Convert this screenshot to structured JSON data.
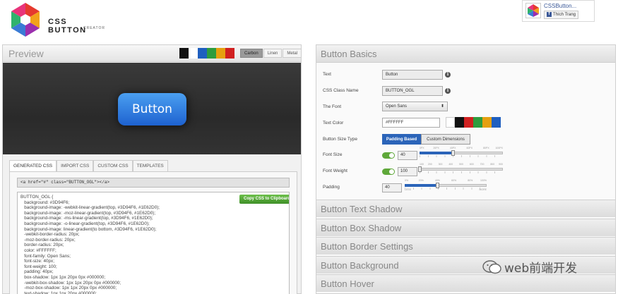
{
  "header": {
    "logo_title": "CSS BUTTON",
    "logo_subtitle": "CREATOR",
    "facebook": {
      "name": "CSSButton...",
      "like_label": "Thích Trang"
    }
  },
  "preview": {
    "title": "Preview",
    "swatch_colors": [
      "#111111",
      "#ffffff",
      "#1f5fbf",
      "#2e9c3e",
      "#e5a010",
      "#d02020"
    ],
    "themes": [
      {
        "label": "Carbon",
        "active": true
      },
      {
        "label": "Linen",
        "active": false
      },
      {
        "label": "Metal",
        "active": false
      }
    ],
    "button_label": "Button",
    "tabs": [
      {
        "label": "GENERATED CSS",
        "active": true
      },
      {
        "label": "IMPORT CSS",
        "active": false
      },
      {
        "label": "CUSTOM CSS",
        "active": false
      },
      {
        "label": "TEMPLATES",
        "active": false
      }
    ],
    "html_snippet": "<a href=\"#\" class=\"BUTTON_OGL\"></a>",
    "copy_label": "Copy CSS to Clipboard",
    "css_lines": [
      "BUTTON_OGL {",
      "   background: #3D94F6;",
      "   background-image: -webkit-linear-gradient(top, #3D94F6, #1E62D0);",
      "   background-image: -moz-linear-gradient(top, #3D94F6, #1E62D0);",
      "   background-image: -ms-linear-gradient(top, #3D94F6, #1E62D0);",
      "   background-image: -o-linear-gradient(top, #3D94F6, #1E62D0);",
      "   background-image: linear-gradient(to bottom, #3D94F6, #1E62D0);",
      "   -webkit-border-radius: 20px;",
      "   -moz-border-radius: 20px;",
      "   border-radius: 20px;",
      "   color: #FFFFFF;",
      "   font-family: Open Sans;",
      "   font-size: 40px;",
      "   font-weight: 100;",
      "   padding: 40px;",
      "   box-shadow: 1px 1px 20px 0px #000000;",
      "   -webkit-box-shadow: 1px 1px 20px 0px #000000;",
      "   -moz-box-shadow: 1px 1px 20px 0px #000000;",
      "   text-shadow: 1px 1px 20px #000000;"
    ]
  },
  "basics": {
    "title": "Button Basics",
    "text_label": "Text",
    "text_value": "Button",
    "class_label": "CSS Class Name",
    "class_value": "BUTTON_OGL",
    "font_label": "The Font",
    "font_value": "Open Sans",
    "color_label": "Text Color",
    "color_value": "#FFFFFF",
    "color_swatches": [
      "#ffffff",
      "#111111",
      "#d02020",
      "#2e9c3e",
      "#e5a010",
      "#1f5fbf"
    ],
    "size_type_label": "Button Size Type",
    "size_type_on": "Padding Based",
    "size_type_off": "Custom Dimensions",
    "font_size_label": "Font Size",
    "font_size_value": "40",
    "font_size_fraction": 0.4,
    "font_size_ticks": [
      "0PX",
      "20PX",
      "40PX",
      "60PX",
      "80PX",
      "100PX"
    ],
    "font_weight_label": "Font Weight",
    "font_weight_value": "100",
    "font_weight_fraction": 0.0,
    "font_weight_ticks": [
      "100",
      "200",
      "300",
      "400",
      "500",
      "600",
      "700",
      "800",
      "900"
    ],
    "padding_label": "Padding",
    "padding_value": "40",
    "padding_fraction": 0.4,
    "padding_ticks": [
      "0%",
      "20%",
      "40%",
      "60%",
      "80%",
      "100%"
    ],
    "padding_less": "LESS",
    "padding_more": "MORE"
  },
  "accordion": [
    "Button Text Shadow",
    "Button Box Shadow",
    "Button Border Settings",
    "Button Background",
    "Button Hover"
  ],
  "watermark": "web前端开发"
}
